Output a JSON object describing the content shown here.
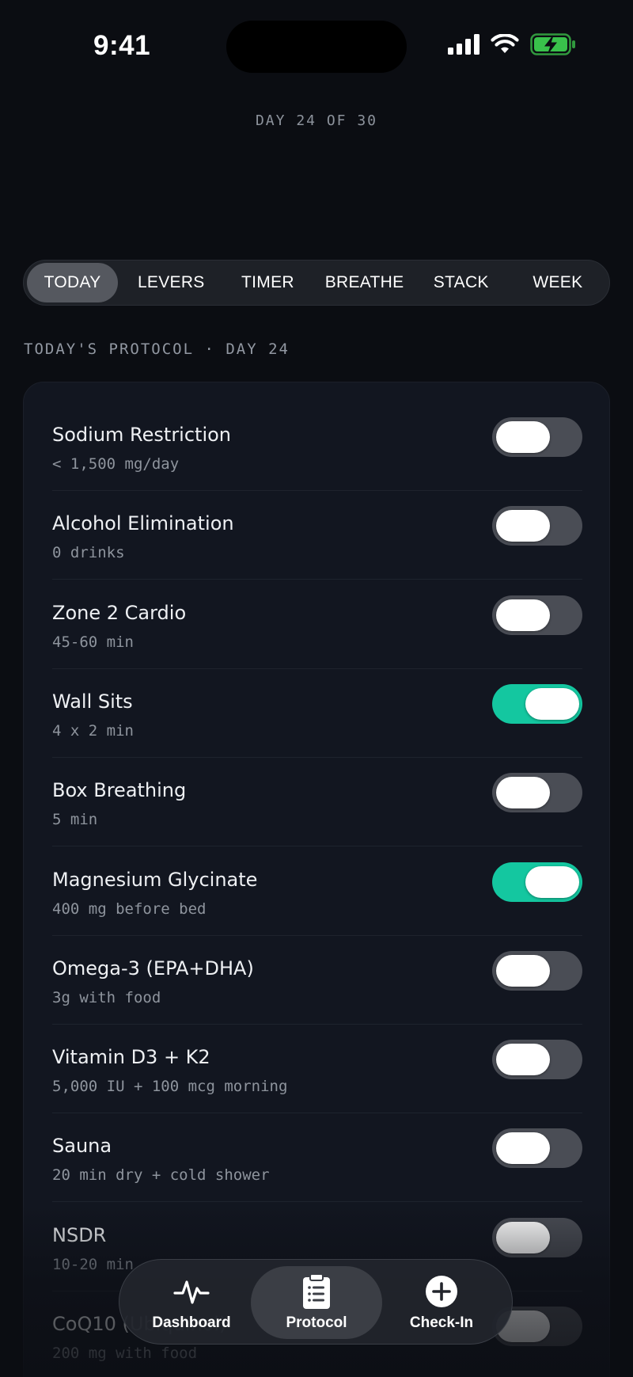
{
  "status_bar": {
    "time": "9:41"
  },
  "header": {
    "day_label": "DAY 24 OF 30"
  },
  "tabs": [
    {
      "label": "TODAY",
      "active": true
    },
    {
      "label": "LEVERS",
      "active": false
    },
    {
      "label": "TIMER",
      "active": false
    },
    {
      "label": "BREATHE",
      "active": false
    },
    {
      "label": "STACK",
      "active": false
    },
    {
      "label": "WEEK",
      "active": false
    }
  ],
  "section": {
    "title": "TODAY'S PROTOCOL · DAY 24"
  },
  "protocol_items": [
    {
      "name": "Sodium Restriction",
      "detail": "< 1,500 mg/day",
      "enabled": false
    },
    {
      "name": "Alcohol Elimination",
      "detail": "0 drinks",
      "enabled": false
    },
    {
      "name": "Zone 2 Cardio",
      "detail": "45-60 min",
      "enabled": false
    },
    {
      "name": "Wall Sits",
      "detail": "4 x 2 min",
      "enabled": true
    },
    {
      "name": "Box Breathing",
      "detail": "5 min",
      "enabled": false
    },
    {
      "name": "Magnesium Glycinate",
      "detail": "400 mg before bed",
      "enabled": true
    },
    {
      "name": "Omega-3 (EPA+DHA)",
      "detail": "3g with food",
      "enabled": false
    },
    {
      "name": "Vitamin D3 + K2",
      "detail": "5,000 IU + 100 mcg morning",
      "enabled": false
    },
    {
      "name": "Sauna",
      "detail": "20 min dry + cold shower",
      "enabled": false
    },
    {
      "name": "NSDR",
      "detail": "10-20 min",
      "enabled": false
    },
    {
      "name": "CoQ10 (Ubiquinol)",
      "detail": "200 mg with food",
      "enabled": false
    }
  ],
  "bottom_nav": [
    {
      "label": "Dashboard",
      "icon": "pulse-icon",
      "active": false
    },
    {
      "label": "Protocol",
      "icon": "clipboard-icon",
      "active": true
    },
    {
      "label": "Check-In",
      "icon": "plus-circle-icon",
      "active": false
    }
  ],
  "colors": {
    "accent": "#14c7a0",
    "background": "#0b0d12",
    "card": "#121620"
  }
}
